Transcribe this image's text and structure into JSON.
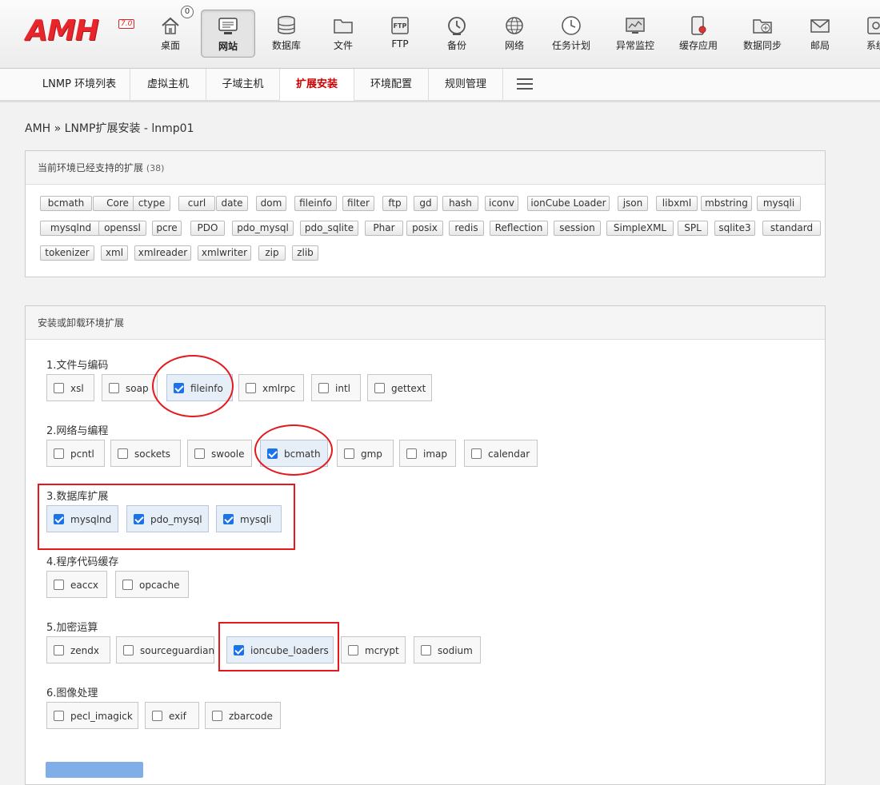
{
  "header": {
    "logo": "AMH",
    "logo_version": "7.0",
    "notice_count": "0",
    "nav": [
      {
        "label": "桌面",
        "icon": "home-icon"
      },
      {
        "label": "网站",
        "icon": "monitor-icon",
        "active": true
      },
      {
        "label": "数据库",
        "icon": "database-icon"
      },
      {
        "label": "文件",
        "icon": "folder-icon"
      },
      {
        "label": "FTP",
        "icon": "ftp-icon"
      },
      {
        "label": "备份",
        "icon": "backup-clock-icon"
      },
      {
        "label": "网络",
        "icon": "globe-icon"
      },
      {
        "label": "任务计划",
        "icon": "clock-icon"
      },
      {
        "label": "异常监控",
        "icon": "monitor-chart-icon"
      },
      {
        "label": "缓存应用",
        "icon": "cache-disk-icon"
      },
      {
        "label": "数据同步",
        "icon": "sync-folder-icon"
      },
      {
        "label": "邮局",
        "icon": "mail-icon"
      },
      {
        "label": "系统",
        "icon": "system-icon"
      }
    ]
  },
  "subnav": {
    "tabs": [
      {
        "label": "LNMP 环境列表"
      },
      {
        "label": "虚拟主机"
      },
      {
        "label": "子域主机"
      },
      {
        "label": "扩展安装",
        "active": true
      },
      {
        "label": "环境配置"
      },
      {
        "label": "规则管理"
      }
    ]
  },
  "breadcrumb": "AMH » LNMP扩展安装 - lnmp01",
  "supported": {
    "title": "当前环境已经支持的扩展",
    "count": "(38)",
    "tags": [
      "bcmath",
      "Core",
      "ctype",
      "curl",
      "date",
      "dom",
      "fileinfo",
      "filter",
      "ftp",
      "gd",
      "hash",
      "iconv",
      "ionCube Loader",
      "json",
      "libxml",
      "mbstring",
      "mysqli",
      "mysqlnd",
      "openssl",
      "pcre",
      "PDO",
      "pdo_mysql",
      "pdo_sqlite",
      "Phar",
      "posix",
      "redis",
      "Reflection",
      "session",
      "SimpleXML",
      "SPL",
      "sqlite3",
      "standard",
      "tokenizer",
      "xml",
      "xmlreader",
      "xmlwriter",
      "zip",
      "zlib"
    ]
  },
  "install": {
    "title": "安装或卸载环境扩展",
    "sections": [
      {
        "title": "1.文件与编码",
        "options": [
          {
            "label": "xsl",
            "checked": false
          },
          {
            "label": "soap",
            "checked": false
          },
          {
            "label": "fileinfo",
            "checked": true
          },
          {
            "label": "xmlrpc",
            "checked": false
          },
          {
            "label": "intl",
            "checked": false
          },
          {
            "label": "gettext",
            "checked": false
          }
        ]
      },
      {
        "title": "2.网络与编程",
        "options": [
          {
            "label": "pcntl",
            "checked": false
          },
          {
            "label": "sockets",
            "checked": false
          },
          {
            "label": "swoole",
            "checked": false
          },
          {
            "label": "bcmath",
            "checked": true
          },
          {
            "label": "gmp",
            "checked": false
          },
          {
            "label": "imap",
            "checked": false
          },
          {
            "label": "calendar",
            "checked": false
          }
        ]
      },
      {
        "title": "3.数据库扩展",
        "options": [
          {
            "label": "mysqlnd",
            "checked": true
          },
          {
            "label": "pdo_mysql",
            "checked": true
          },
          {
            "label": "mysqli",
            "checked": true
          }
        ]
      },
      {
        "title": "4.程序代码缓存",
        "options": [
          {
            "label": "eaccx",
            "checked": false
          },
          {
            "label": "opcache",
            "checked": false
          }
        ]
      },
      {
        "title": "5.加密运算",
        "options": [
          {
            "label": "zendx",
            "checked": false
          },
          {
            "label": "sourceguardian",
            "checked": false
          },
          {
            "label": "ioncube_loaders",
            "checked": true
          },
          {
            "label": "mcrypt",
            "checked": false
          },
          {
            "label": "sodium",
            "checked": false
          }
        ]
      },
      {
        "title": "6.图像处理",
        "options": [
          {
            "label": "pecl_imagick",
            "checked": false
          },
          {
            "label": "exif",
            "checked": false
          },
          {
            "label": "zbarcode",
            "checked": false
          }
        ]
      }
    ]
  }
}
